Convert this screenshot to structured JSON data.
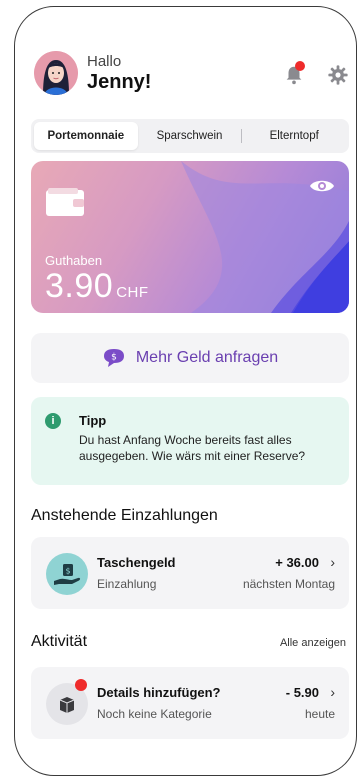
{
  "header": {
    "greeting": "Hallo",
    "name": "Jenny!",
    "icons": {
      "avatar": "user-avatar",
      "notifications": "bell-icon",
      "settings": "gear-icon"
    },
    "notification_dot_color": "#ef2b2b"
  },
  "tabs": [
    {
      "label": "Portemonnaie",
      "active": true
    },
    {
      "label": "Sparschwein",
      "active": false
    },
    {
      "label": "Elterntopf",
      "active": false
    }
  ],
  "balance_card": {
    "label": "Guthaben",
    "amount": "3.90",
    "currency": "CHF",
    "icons": {
      "wallet": "wallet-icon",
      "visibility": "eye-icon"
    },
    "gradient_colors": [
      "#e8a9b6",
      "#b58ad6",
      "#4b3fd8"
    ]
  },
  "request_money": {
    "label": "Mehr Geld anfragen",
    "icon": "chat-coin-icon",
    "accent": "#6a3fb0"
  },
  "tip": {
    "title": "Tipp",
    "text": "Du hast Anfang Woche bereits fast alles ausgegeben. Wie wärs mit einer Reserve?",
    "icon": "info-icon",
    "background": "#e6f7f1"
  },
  "upcoming": {
    "title": "Anstehende Einzahlungen",
    "items": [
      {
        "title": "Taschengeld",
        "subtitle": "Einzahlung",
        "amount": "+ 36.00",
        "date": "nächsten Montag",
        "icon": "hand-money-icon"
      }
    ]
  },
  "activity": {
    "title": "Aktivität",
    "see_all": "Alle anzeigen",
    "items": [
      {
        "title": "Details hinzufügen?",
        "subtitle": "Noch keine Kategorie",
        "amount": "- 5.90",
        "date": "heute",
        "icon": "package-icon"
      }
    ]
  }
}
